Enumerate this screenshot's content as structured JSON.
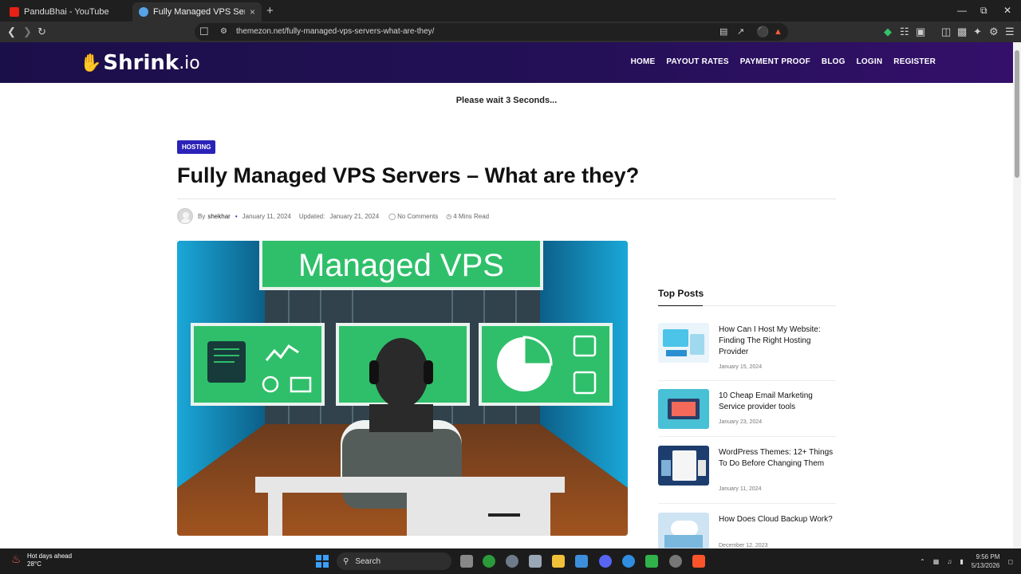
{
  "browser": {
    "tabs": [
      {
        "title": "PanduBhai - YouTube",
        "active": false
      },
      {
        "title": "Fully Managed VPS Servers – Wh",
        "active": true
      }
    ],
    "new_tab": "+",
    "tab_close": "×",
    "url": "themezon.net/fully-managed-vps-servers-what-are-they/"
  },
  "site": {
    "logo_text": "Shrink",
    "logo_suffix": ".io",
    "nav": [
      "HOME",
      "PAYOUT RATES",
      "PAYMENT PROOF",
      "BLOG",
      "LOGIN",
      "REGISTER"
    ],
    "wait_text": "Please wait  3  Seconds..."
  },
  "article": {
    "category": "HOSTING",
    "title": "Fully Managed VPS Servers – What are they?",
    "by": "By",
    "author": "shekhar",
    "date": "January 11, 2024",
    "updated_label": "Updated:",
    "updated": "January 21, 2024",
    "comments": "No Comments",
    "read_time": "4 Mins Read",
    "hero_text": "Managed VPS"
  },
  "sidebar": {
    "title": "Top Posts",
    "posts": [
      {
        "title": "How Can I Host My Website: Finding The Right Hosting Provider",
        "date": "January 15, 2024"
      },
      {
        "title": "10 Cheap Email Marketing Service provider tools",
        "date": "January 23, 2024"
      },
      {
        "title": "WordPress Themes: 12+ Things To Do Before Changing Them",
        "date": "January 11, 2024"
      },
      {
        "title": "How Does Cloud Backup Work?",
        "date": "December 12, 2023"
      }
    ]
  },
  "taskbar": {
    "weather_title": "Hot days ahead",
    "weather_temp": "28°C",
    "search": "Search",
    "time": "9:56 PM",
    "date": "5/13/2026"
  },
  "colors": {
    "header_start": "#1b0f4a",
    "header_end": "#34106a",
    "category_badge": "#2b23b8",
    "logo_accent": "#f3b233",
    "hero_green": "#2fbf6a"
  }
}
